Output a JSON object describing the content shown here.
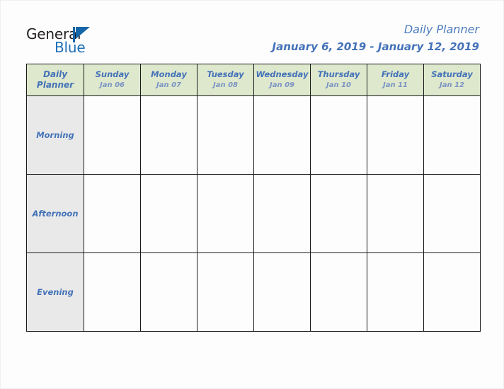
{
  "brand": {
    "word1": "General",
    "word2": "Blue",
    "accent_color": "#1565a8",
    "triangle_icon": "triangle-icon"
  },
  "header": {
    "title": "Daily Planner",
    "date_range": "January 6, 2019 - January 12, 2019",
    "title_color": "#4472b8"
  },
  "table": {
    "corner": {
      "line1": "Daily",
      "line2": "Planner"
    },
    "header_bg": "#dee8cd",
    "rowlabel_bg": "#e9e9e9",
    "border_color": "#1a1a1a",
    "columns": [
      {
        "day": "Sunday",
        "date": "Jan 06"
      },
      {
        "day": "Monday",
        "date": "Jan 07"
      },
      {
        "day": "Tuesday",
        "date": "Jan 08"
      },
      {
        "day": "Wednesday",
        "date": "Jan 09"
      },
      {
        "day": "Thursday",
        "date": "Jan 10"
      },
      {
        "day": "Friday",
        "date": "Jan 11"
      },
      {
        "day": "Saturday",
        "date": "Jan 12"
      }
    ],
    "rows": [
      {
        "label": "Morning",
        "cells": [
          "",
          "",
          "",
          "",
          "",
          "",
          ""
        ]
      },
      {
        "label": "Afternoon",
        "cells": [
          "",
          "",
          "",
          "",
          "",
          "",
          ""
        ]
      },
      {
        "label": "Evening",
        "cells": [
          "",
          "",
          "",
          "",
          "",
          "",
          ""
        ]
      }
    ]
  }
}
